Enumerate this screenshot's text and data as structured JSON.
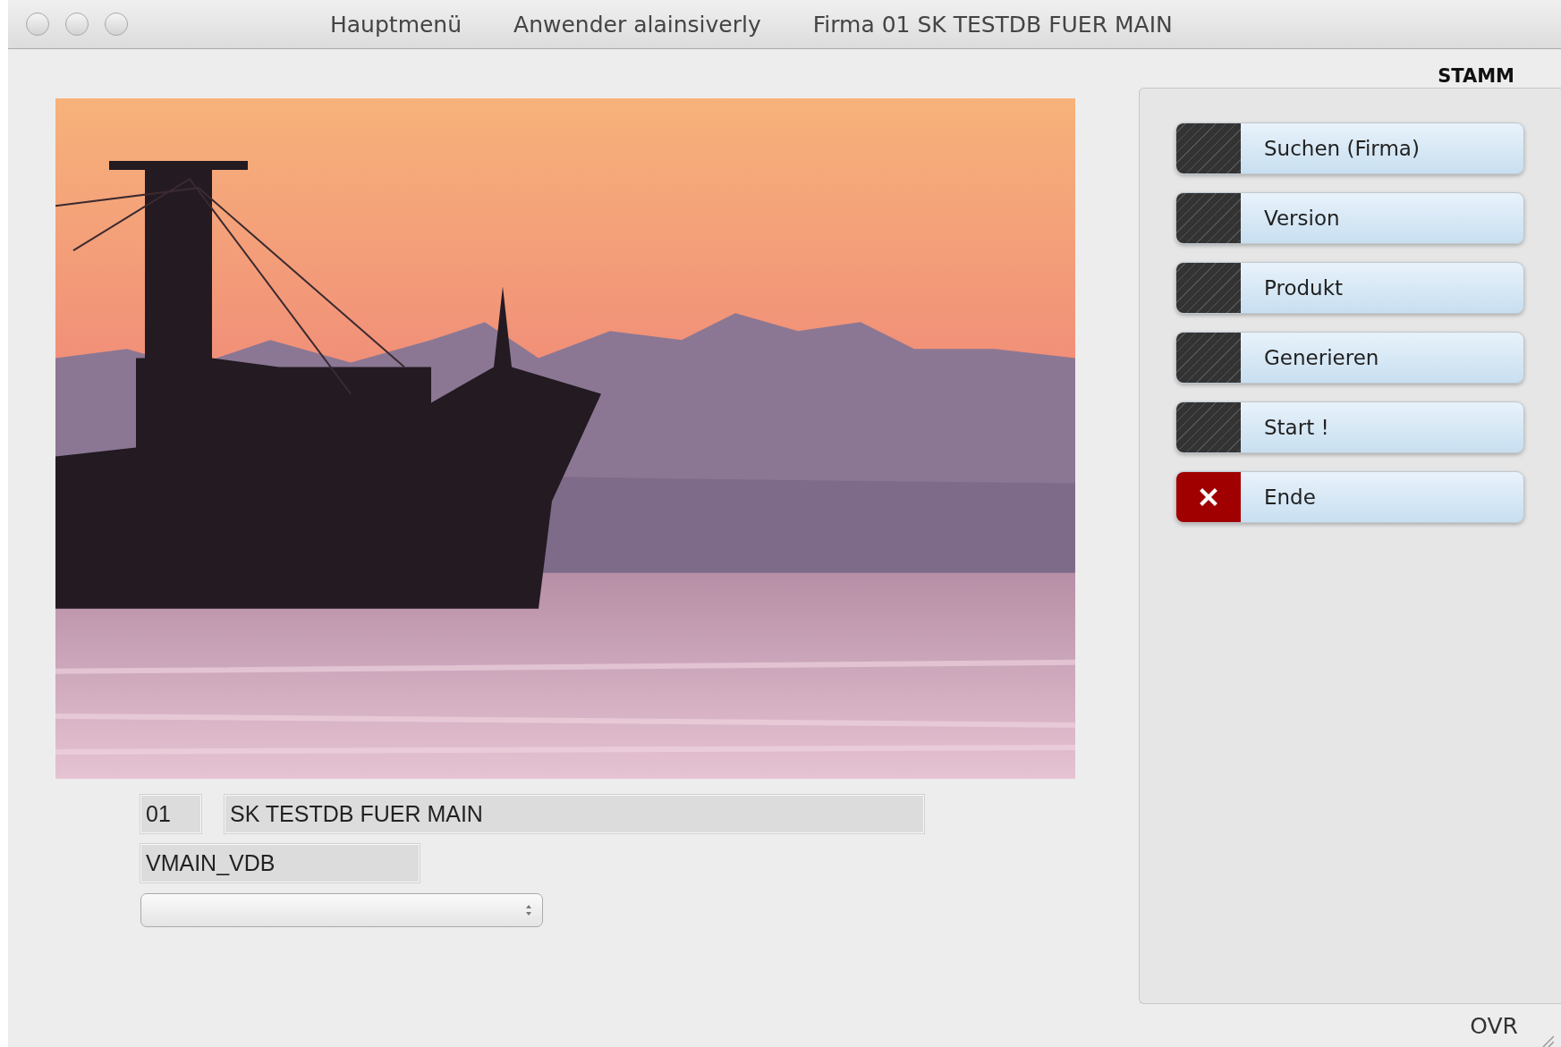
{
  "window": {
    "title_items": [
      "Hauptmenü",
      "Anwender alainsiverly",
      "Firma 01 SK TESTDB FUER MAIN"
    ]
  },
  "company": {
    "number": "01",
    "name": "SK TESTDB FUER MAIN",
    "database": "VMAIN_VDB"
  },
  "panel": {
    "tab": "STAMM",
    "buttons": [
      {
        "label": "Suchen (Firma)",
        "kind": "plain"
      },
      {
        "label": "Version",
        "kind": "plain"
      },
      {
        "label": "Produkt",
        "kind": "plain"
      },
      {
        "label": "Generieren",
        "kind": "plain"
      },
      {
        "label": "Start !",
        "kind": "plain"
      },
      {
        "label": "Ende",
        "kind": "exit"
      }
    ]
  },
  "status_bar": {
    "mode": "OVR"
  }
}
